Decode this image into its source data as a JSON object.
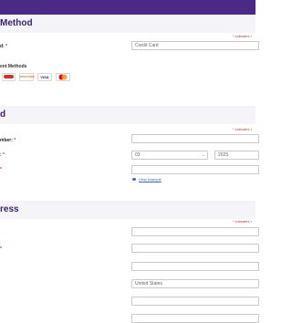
{
  "payment_method": {
    "title": "Method",
    "required_note": "* indicates r",
    "field_label": "d:",
    "field_required": "*",
    "field_value": "Credit Card",
    "methods_label": "ent Methods",
    "cards": [
      {
        "name": "Discover-like",
        "label": ""
      },
      {
        "name": "Discover",
        "label": "DISCOVER"
      },
      {
        "name": "Visa",
        "label": "VISA"
      },
      {
        "name": "Mastercard",
        "label": ""
      }
    ]
  },
  "card": {
    "title": "d",
    "required_note": "* indicates r",
    "number_label": "mber:",
    "number_required": "*",
    "expiry_label": ":",
    "expiry_required": "*",
    "expiry_month": "03",
    "expiry_year": "2025",
    "cvv_required": "*",
    "view_example": "View example"
  },
  "address": {
    "title": "ress",
    "required_note": "* indicates r",
    "required_star": "*",
    "country_value": "United States"
  },
  "colors": {
    "brand": "#4b2a86",
    "required": "#c0392b",
    "link": "#3366cc"
  }
}
